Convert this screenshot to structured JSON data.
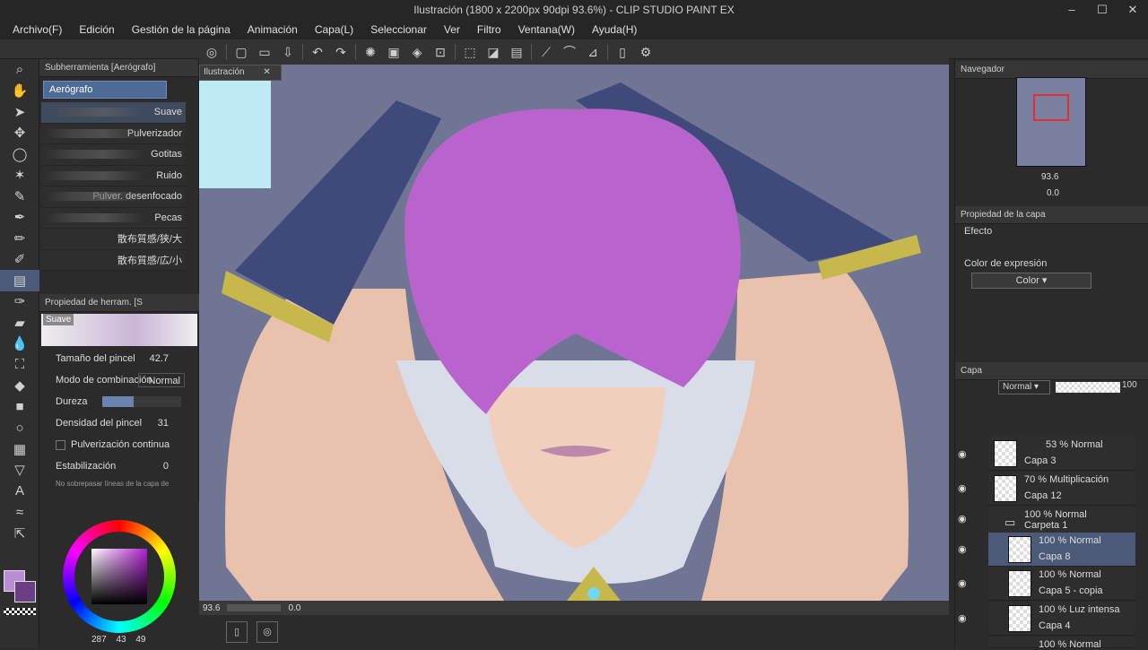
{
  "window": {
    "title": "Ilustración (1800 x 2200px 90dpi 93.6%) - CLIP STUDIO PAINT EX",
    "min": "–",
    "max": "☐",
    "close": "✕"
  },
  "menu": [
    "Archivo(F)",
    "Edición",
    "Gestión de la página",
    "Animación",
    "Capa(L)",
    "Seleccionar",
    "Ver",
    "Filtro",
    "Ventana(W)",
    "Ayuda(H)"
  ],
  "subtool": {
    "header": "Subherramienta [Aerógrafo]",
    "tab": "Aerógrafo",
    "brushes": [
      "Suave",
      "Pulverizador",
      "Gotitas",
      "Ruido",
      "Pulver. desenfocado",
      "Pecas",
      "散布質感/狭/大",
      "散布質感/広/小"
    ]
  },
  "toolprop": {
    "header": "Propiedad de herram. [S",
    "preview_label": "Suave",
    "size_label": "Tamaño del pincel",
    "size_value": "42.7",
    "blend_label": "Modo de combinación",
    "blend_value": "Normal",
    "hard_label": "Dureza",
    "density_label": "Densidad del pincel",
    "density_value": "31",
    "cont_label": "Pulverización continua",
    "stab_label": "Estabilización",
    "stab_value": "0",
    "extra_label": "No sobrepasar líneas de la capa de"
  },
  "color": {
    "main": "#b98ed4",
    "sub": "#6b3f84",
    "val1": "287",
    "val2": "43",
    "val3": "49"
  },
  "canvas": {
    "tab": "Ilustración",
    "zoom": "93.6",
    "angle": "0.0"
  },
  "navigator": {
    "title": "Navegador",
    "zoom": "93.6",
    "angle": "0.0"
  },
  "layerprop": {
    "title": "Propiedad de la capa",
    "effect": "Efecto",
    "expr": "Color de expresión",
    "expr_value": "Color"
  },
  "layers": {
    "title": "Capa",
    "blend": "Normal",
    "opacity": "100",
    "items": [
      {
        "mode": "53 % Normal",
        "name": "Capa 3"
      },
      {
        "mode": "70 % Multiplicación",
        "name": "Capa 12"
      },
      {
        "mode": "100 % Normal",
        "name": "Carpeta 1"
      },
      {
        "mode": "100 % Normal",
        "name": "Capa 8"
      },
      {
        "mode": "100 % Normal",
        "name": "Capa 5 - copia"
      },
      {
        "mode": "100 % Luz intensa",
        "name": "Capa 4"
      },
      {
        "mode": "100 % Normal",
        "name": ""
      }
    ]
  }
}
